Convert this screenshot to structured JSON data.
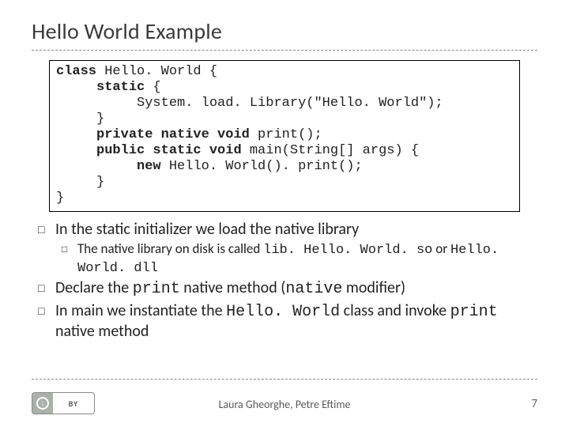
{
  "title": "Hello World Example",
  "code": {
    "l1a": "class",
    "l1b": " Hello. World {",
    "l2a": "static",
    "l2b": " {",
    "l3": "System. load. Library(\"Hello. World\");",
    "l4": "}",
    "l5a": "private native void",
    "l5b": " print();",
    "l6a": "public static void",
    "l6b": " main(String[] args) {",
    "l7a": "new",
    "l7b": " Hello. World(). print();",
    "l8": "}",
    "l9": "}"
  },
  "bullets": {
    "b1": "In the static initializer we load the native library",
    "b1a_pre": "The native library on disk is called ",
    "b1a_code1": "lib. Hello. World. so",
    "b1a_mid": " or ",
    "b1a_code2": "Hello. World. dll",
    "b2_pre": "Declare the ",
    "b2_code1": "print",
    "b2_mid": " native method (",
    "b2_code2": "native",
    "b2_post": " modifier)",
    "b3_pre": "In main we instantiate the ",
    "b3_code1": "Hello. World",
    "b3_mid": " class and invoke ",
    "b3_code2": "print",
    "b3_post": " native method"
  },
  "footer": {
    "authors": "Laura Gheorghe, Petre Eftime",
    "page": "7",
    "cc": "BY"
  }
}
